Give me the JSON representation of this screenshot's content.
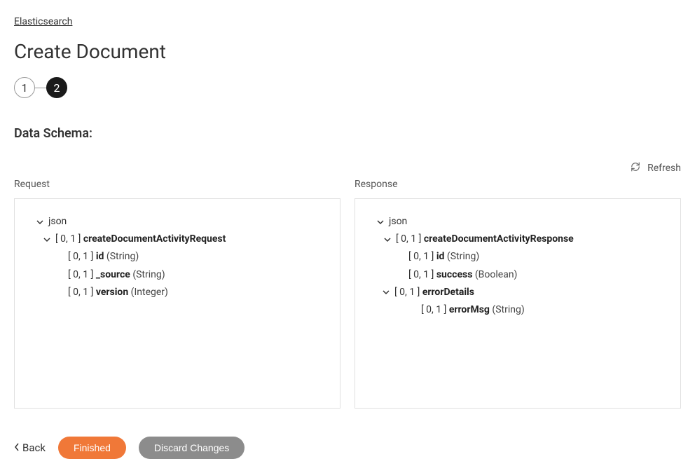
{
  "breadcrumb": {
    "root": "Elasticsearch"
  },
  "page": {
    "title": "Create Document"
  },
  "stepper": {
    "step1": "1",
    "step2": "2"
  },
  "section": {
    "title": "Data Schema:"
  },
  "refresh": {
    "label": "Refresh"
  },
  "columns": {
    "request": {
      "label": "Request"
    },
    "response": {
      "label": "Response"
    }
  },
  "request_tree": {
    "root": {
      "name": "json"
    },
    "n1": {
      "card": "[ 0, 1 ]",
      "name": "createDocumentActivityRequest"
    },
    "n1a": {
      "card": "[ 0, 1 ]",
      "name": "id",
      "type": "(String)"
    },
    "n1b": {
      "card": "[ 0, 1 ]",
      "name": "_source",
      "type": "(String)"
    },
    "n1c": {
      "card": "[ 0, 1 ]",
      "name": "version",
      "type": "(Integer)"
    }
  },
  "response_tree": {
    "root": {
      "name": "json"
    },
    "n1": {
      "card": "[ 0, 1 ]",
      "name": "createDocumentActivityResponse"
    },
    "n1a": {
      "card": "[ 0, 1 ]",
      "name": "id",
      "type": "(String)"
    },
    "n1b": {
      "card": "[ 0, 1 ]",
      "name": "success",
      "type": "(Boolean)"
    },
    "n1c": {
      "card": "[ 0, 1 ]",
      "name": "errorDetails"
    },
    "n1c1": {
      "card": "[ 0, 1 ]",
      "name": "errorMsg",
      "type": "(String)"
    }
  },
  "footer": {
    "back": "Back",
    "finished": "Finished",
    "discard": "Discard Changes"
  }
}
